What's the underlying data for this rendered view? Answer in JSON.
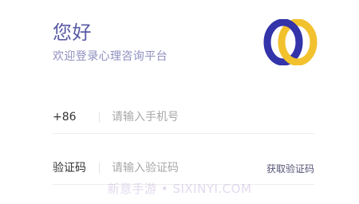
{
  "header": {
    "greeting": "您好",
    "subtitle": "欢迎登录心理咨询平台",
    "logo": {
      "icon": "overlapping-rings-logo",
      "colors": [
        "#3333aa",
        "#f2c12e"
      ]
    }
  },
  "form": {
    "phone": {
      "prefix": "+86",
      "placeholder": "请输入手机号"
    },
    "code": {
      "label": "验证码",
      "placeholder": "请输入验证码",
      "get_code_label": "获取验证码"
    }
  },
  "watermark": "新意手游 • SIXINYI.COM",
  "colors": {
    "title": "#5a5aa6",
    "subtitle": "#8f8fc0",
    "divider": "#eeeeee"
  }
}
